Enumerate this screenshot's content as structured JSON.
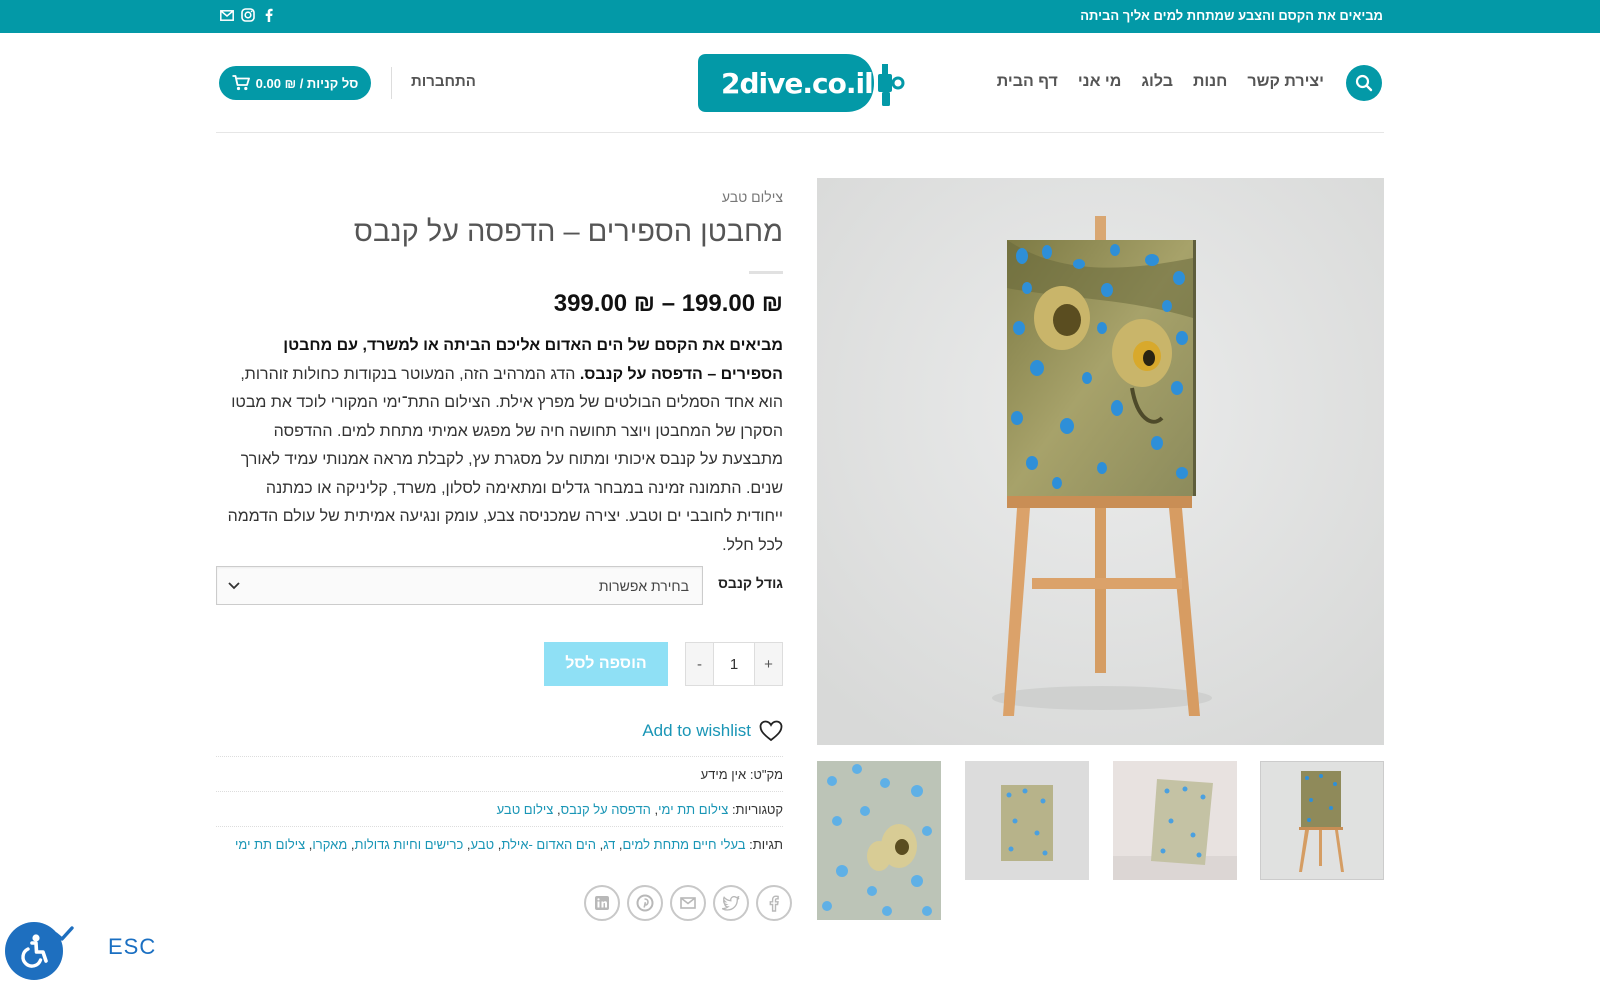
{
  "topbar": {
    "promo": "מביאים את הקסם והצבע שמתחת למים אליך הביתה",
    "social": [
      "email-icon",
      "instagram-icon",
      "facebook-icon"
    ]
  },
  "header": {
    "logo_text": "2dive.co.il",
    "nav": [
      "דף הבית",
      "מי אני",
      "בלוג",
      "חנות",
      "יצירת קשר"
    ],
    "login": "התחברות",
    "cart": "סל קניות / ₪ 0.00"
  },
  "product": {
    "breadcrumb": "צילום טבע",
    "title": "מחבטן הספירים – הדפסה על קנבס",
    "price": "₪ 199.00 – ₪ 399.00",
    "desc_bold": "מביאים את הקסם של הים האדום אליכם הביתה או למשרד, עם מחבטן הספירים – הדפסה על קנבס.",
    "desc_rest": " הדג המרהיב הזה, המעוטר בנקודות כחולות זוהרות, הוא אחד הסמלים הבולטים של מפרץ אילת. הצילום התת־ימי המקורי לוכד את מבטו הסקרן של המחבטן ויוצר תחושה חיה של מפגש אמיתי מתחת למים. ההדפסה מתבצעת על קנבס איכותי ומתוח על מסגרת עץ, לקבלת מראה אמנותי עמיד לאורך שנים. התמונה זמינה במבחר גדלים ומתאימה לסלון, משרד, קליניקה או כמתנה ייחודית לחובבי ים וטבע. יצירה שמכניסה צבע, עומק ונגיעה אמיתית של עולם הדממה לכל חלל.",
    "variation_label": "גודל קנבס",
    "variation_placeholder": "בחירת אפשרות",
    "qty_minus": "-",
    "qty_value": "1",
    "qty_plus": "+",
    "add_to_cart": "הוספה לסל",
    "wishlist": "Add to wishlist",
    "sku_label": "מק\"ט:",
    "sku_value": "אין מידע",
    "categories_label": "קטגוריות:",
    "categories": [
      "צילום תת ימי",
      "הדפסה על קנבס",
      "צילום טבע"
    ],
    "tags_label": "תגיות:",
    "tags": [
      "בעלי חיים מתחת למים",
      "דג",
      "הים האדום -אילת",
      "טבע",
      "כרישים וחיות גדולות",
      "מאקרו",
      "צילום תת ימי"
    ],
    "share": [
      "facebook-icon",
      "twitter-icon",
      "email-icon",
      "pinterest-icon",
      "linkedin-icon"
    ]
  },
  "accessibility": {
    "esc": "ESC"
  },
  "colors": {
    "brand": "#0399a7",
    "link": "#1a96b6",
    "add_to_cart_bg": "#8fe0f5",
    "stingray_spots": "#2e8fd8"
  }
}
